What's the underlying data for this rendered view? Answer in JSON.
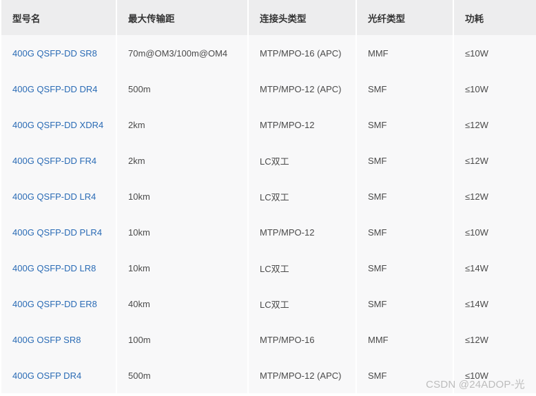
{
  "table": {
    "headers": [
      "型号名",
      "最大传输距",
      "连接头类型",
      "光纤类型",
      "功耗"
    ],
    "rows": [
      {
        "model": "400G QSFP-DD SR8",
        "distance": "70m@OM3/100m@OM4",
        "connector": "MTP/MPO-16 (APC)",
        "fiber": "MMF",
        "power": "≤10W"
      },
      {
        "model": "400G QSFP-DD DR4",
        "distance": "500m",
        "connector": "MTP/MPO-12 (APC)",
        "fiber": "SMF",
        "power": "≤10W"
      },
      {
        "model": "400G QSFP-DD XDR4",
        "distance": "2km",
        "connector": "MTP/MPO-12",
        "fiber": "SMF",
        "power": "≤12W"
      },
      {
        "model": "400G QSFP-DD FR4",
        "distance": "2km",
        "connector": "LC双工",
        "fiber": "SMF",
        "power": "≤12W"
      },
      {
        "model": "400G QSFP-DD LR4",
        "distance": "10km",
        "connector": "LC双工",
        "fiber": "SMF",
        "power": "≤12W"
      },
      {
        "model": "400G QSFP-DD PLR4",
        "distance": "10km",
        "connector": "MTP/MPO-12",
        "fiber": "SMF",
        "power": "≤10W"
      },
      {
        "model": "400G QSFP-DD LR8",
        "distance": "10km",
        "connector": "LC双工",
        "fiber": "SMF",
        "power": "≤14W"
      },
      {
        "model": "400G QSFP-DD ER8",
        "distance": "40km",
        "connector": "LC双工",
        "fiber": "SMF",
        "power": "≤14W"
      },
      {
        "model": "400G OSFP SR8",
        "distance": "100m",
        "connector": "MTP/MPO-16",
        "fiber": "MMF",
        "power": "≤12W"
      },
      {
        "model": "400G OSFP DR4",
        "distance": "500m",
        "connector": "MTP/MPO-12 (APC)",
        "fiber": "SMF",
        "power": "≤10W"
      }
    ]
  },
  "watermark": "CSDN @24ADOP-光",
  "colors": {
    "header_bg": "#ededee",
    "row_bg": "#f8f8f9",
    "link": "#2a6bb5",
    "text": "#4a4a4a"
  }
}
